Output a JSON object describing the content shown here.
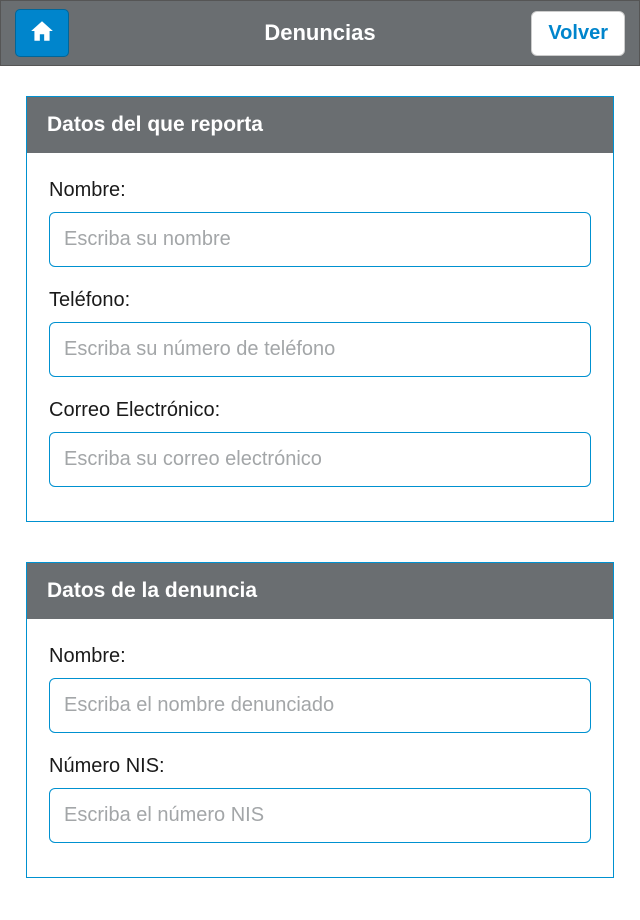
{
  "header": {
    "title": "Denuncias",
    "back_label": "Volver"
  },
  "sections": {
    "reporter": {
      "title": "Datos del que reporta",
      "fields": {
        "name": {
          "label": "Nombre:",
          "placeholder": "Escriba su nombre",
          "value": ""
        },
        "phone": {
          "label": "Teléfono:",
          "placeholder": "Escriba su número de teléfono",
          "value": ""
        },
        "email": {
          "label": "Correo Electrónico:",
          "placeholder": "Escriba su correo electrónico",
          "value": ""
        }
      }
    },
    "complaint": {
      "title": "Datos de la denuncia",
      "fields": {
        "name": {
          "label": "Nombre:",
          "placeholder": "Escriba el nombre denunciado",
          "value": ""
        },
        "nis": {
          "label": "Número NIS:",
          "placeholder": "Escriba el número NIS",
          "value": ""
        }
      }
    }
  }
}
